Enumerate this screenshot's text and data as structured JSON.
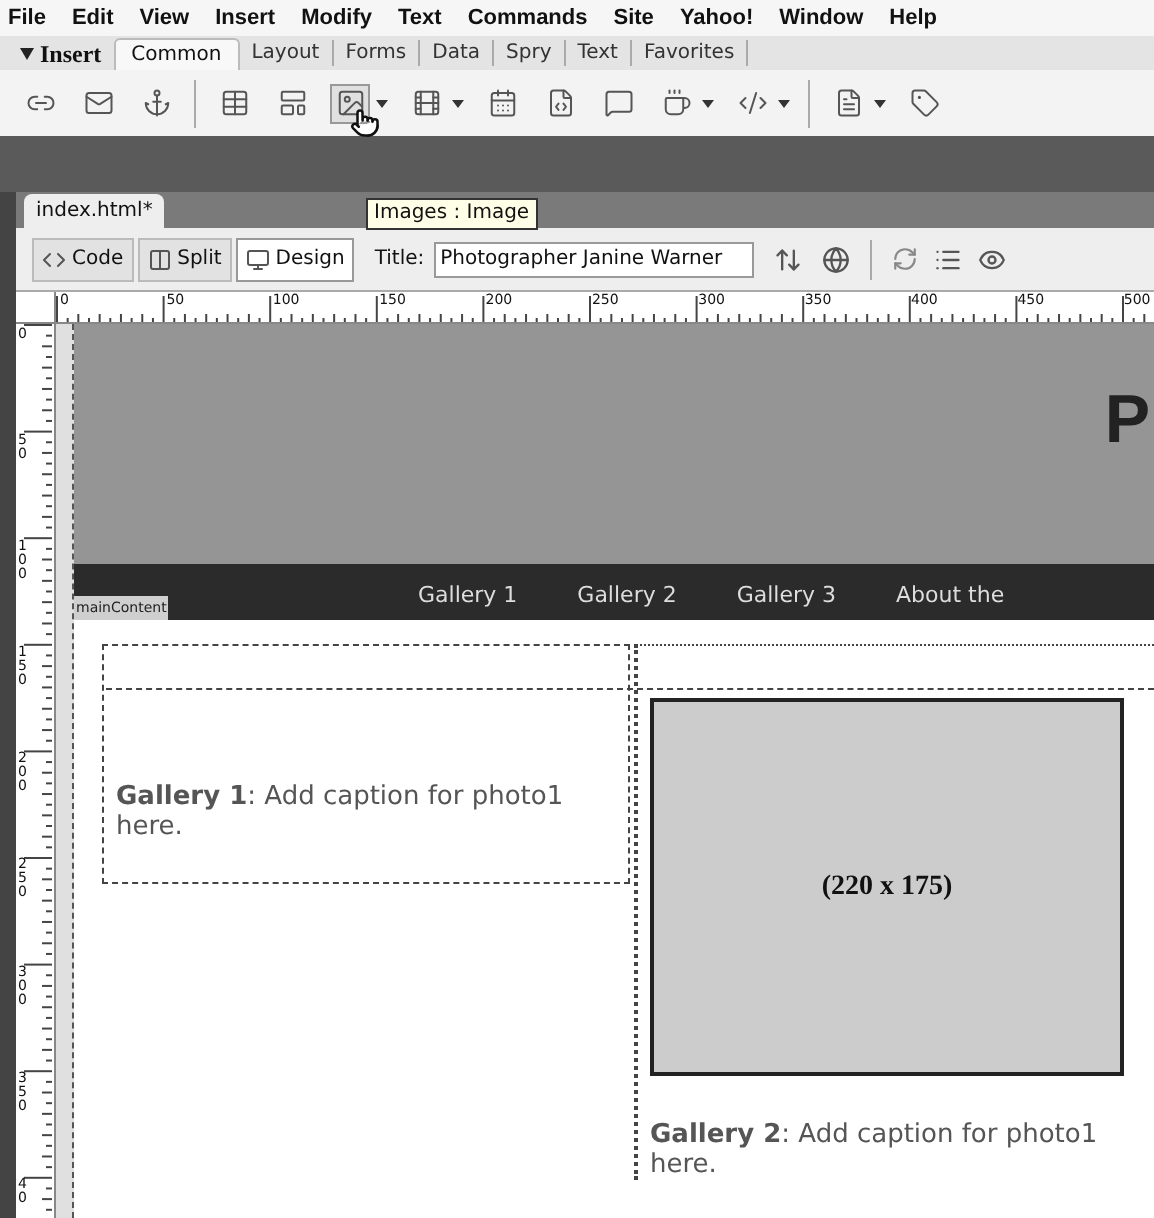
{
  "menu_bar": [
    "File",
    "Edit",
    "View",
    "Insert",
    "Modify",
    "Text",
    "Commands",
    "Site",
    "Yahoo!",
    "Window",
    "Help"
  ],
  "insert_bar": {
    "label": "Insert",
    "expanded": true,
    "tabs": [
      {
        "label": "Common",
        "selected": true
      },
      {
        "label": "Layout",
        "selected": false
      },
      {
        "label": "Forms",
        "selected": false
      },
      {
        "label": "Data",
        "selected": false
      },
      {
        "label": "Spry",
        "selected": false
      },
      {
        "label": "Text",
        "selected": false
      },
      {
        "label": "Favorites",
        "selected": false
      }
    ]
  },
  "toolbar": {
    "buttons": [
      {
        "kind": "link",
        "dropdown": false,
        "hovered": false,
        "group_end": false
      },
      {
        "kind": "email",
        "dropdown": false,
        "hovered": false,
        "group_end": false
      },
      {
        "kind": "anchor",
        "dropdown": false,
        "hovered": false,
        "group_end": true
      },
      {
        "kind": "table",
        "dropdown": false,
        "hovered": false,
        "group_end": false
      },
      {
        "kind": "div",
        "dropdown": false,
        "hovered": false,
        "group_end": false
      },
      {
        "kind": "image",
        "dropdown": true,
        "hovered": true,
        "group_end": false
      },
      {
        "kind": "media",
        "dropdown": true,
        "hovered": false,
        "group_end": false
      },
      {
        "kind": "date",
        "dropdown": false,
        "hovered": false,
        "group_end": false
      },
      {
        "kind": "include",
        "dropdown": false,
        "hovered": false,
        "group_end": false
      },
      {
        "kind": "comment",
        "dropdown": false,
        "hovered": false,
        "group_end": false
      },
      {
        "kind": "head",
        "dropdown": true,
        "hovered": false,
        "group_end": false
      },
      {
        "kind": "script",
        "dropdown": true,
        "hovered": false,
        "group_end": true
      },
      {
        "kind": "template",
        "dropdown": true,
        "hovered": false,
        "group_end": false
      },
      {
        "kind": "tag",
        "dropdown": false,
        "hovered": false,
        "group_end": false
      }
    ]
  },
  "tooltip": "Images : Image",
  "document": {
    "tab": "index.html*",
    "view_buttons": [
      {
        "label": "Code",
        "kind": "code",
        "selected": false
      },
      {
        "label": "Split",
        "kind": "split",
        "selected": false
      },
      {
        "label": "Design",
        "kind": "design",
        "selected": true
      }
    ],
    "title_label": "Title:",
    "title_value": "Photographer Janine Warner"
  },
  "ruler": {
    "h_labels": [
      "0",
      "50",
      "100",
      "150",
      "200",
      "250",
      "300",
      "350",
      "400",
      "450",
      "500"
    ],
    "v_labels": [
      "0",
      "50",
      "100",
      "150",
      "200",
      "250",
      "300",
      "350",
      "40"
    ]
  },
  "page": {
    "header_text": "P",
    "nav": [
      "Gallery 1",
      "Gallery 2",
      "Gallery 3",
      "About the"
    ],
    "tag_label": "mainContent",
    "captions": [
      "**Gallery 1**: Add caption for photo1 here.",
      "**Gallery 2**: Add caption for photo1 here."
    ],
    "image_placeholder": "(220 x 175)"
  }
}
